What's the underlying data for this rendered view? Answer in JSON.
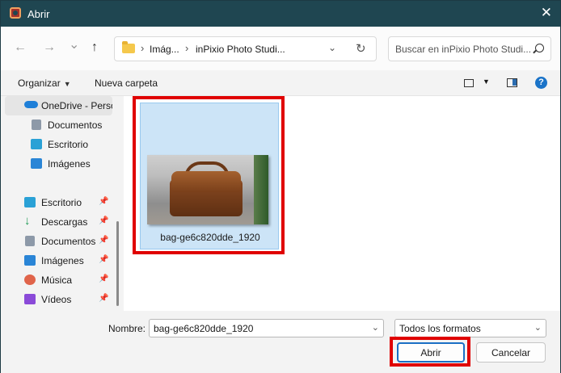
{
  "window": {
    "title": "Abrir",
    "close_glyph": "✕"
  },
  "navigation": {
    "back_glyph": "←",
    "forward_glyph": "→",
    "recent_glyph": "⌄",
    "up_glyph": "↑",
    "breadcrumb": [
      "Imág...",
      "inPixio Photo Studi..."
    ],
    "crumb_separator": "›",
    "address_dropdown_glyph": "⌄",
    "refresh_glyph": "↻",
    "search_placeholder": "Buscar en inPixio Photo Studi..."
  },
  "toolbar": {
    "organize_label": "Organizar",
    "organize_dropdown": "▼",
    "new_folder_label": "Nueva carpeta",
    "view_dropdown": "▼",
    "help_label": "?"
  },
  "sidebar": {
    "pin_glyph": "📌",
    "items": [
      {
        "label": "OneDrive - Perso",
        "icon": "onedrive-cloud-icon",
        "color": "#1e7fd8"
      },
      {
        "label": "Documentos",
        "icon": "documents-icon",
        "color": "#8d99a8"
      },
      {
        "label": "Escritorio",
        "icon": "desktop-icon",
        "color": "#2aa1d6"
      },
      {
        "label": "Imágenes",
        "icon": "pictures-icon",
        "color": "#2a85d6"
      },
      {
        "label": "Escritorio",
        "icon": "desktop-icon",
        "color": "#2aa1d6"
      },
      {
        "label": "Descargas",
        "icon": "downloads-icon",
        "color": "#1f9a55"
      },
      {
        "label": "Documentos",
        "icon": "documents-icon",
        "color": "#8d99a8"
      },
      {
        "label": "Imágenes",
        "icon": "pictures-icon",
        "color": "#2a85d6"
      },
      {
        "label": "Música",
        "icon": "music-icon",
        "color": "#e0644a"
      },
      {
        "label": "Vídeos",
        "icon": "videos-icon",
        "color": "#8a4ad8"
      }
    ]
  },
  "content": {
    "files": [
      {
        "name": "bag-ge6c820dde_1920",
        "selected": true
      }
    ]
  },
  "bottom": {
    "name_label": "Nombre:",
    "name_value": "bag-ge6c820dde_1920",
    "filter_value": "Todos los formatos",
    "dropdown_glyph": "⌄",
    "open_label": "Abrir",
    "cancel_label": "Cancelar"
  },
  "colors": {
    "titlebar": "#1f4651",
    "selection": "#cce4f7",
    "highlight": "#e00000",
    "accent": "#1a6fc4"
  }
}
